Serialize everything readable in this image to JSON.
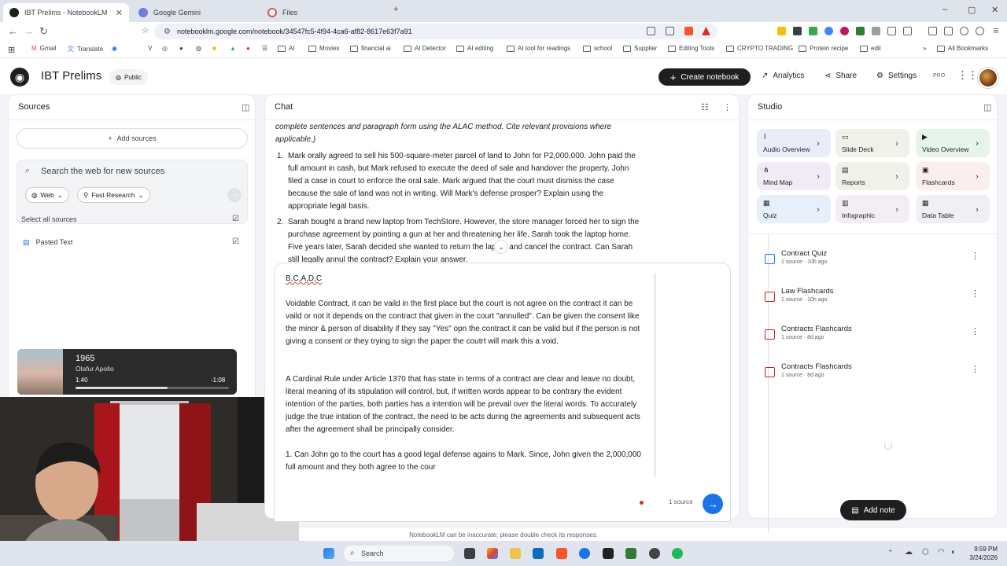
{
  "browser": {
    "tabs": [
      {
        "title": "IBT Prelims - NotebookLM",
        "active": true
      },
      {
        "title": "Google Gemini",
        "active": false
      },
      {
        "title": "Files",
        "active": false
      }
    ],
    "url": "notebooklm.google.com/notebook/34547fc5-4f94-4ca6-af82-8617e63f7a91",
    "bookmarks": [
      "Gmail",
      "Translate",
      "AI",
      "Movies",
      "financial ai",
      "AI Detector",
      "AI editing",
      "AI tool for readings",
      "school",
      "Supplier",
      "Editing Tools",
      "CRYPTO TRADING",
      "Protein recipe",
      "edit"
    ],
    "all_bookmarks": "All Bookmarks"
  },
  "app": {
    "notebook_title": "IBT Prelims",
    "public_label": "Public",
    "create_label": "Create notebook",
    "analytics_label": "Analytics",
    "share_label": "Share",
    "settings_label": "Settings",
    "pro_label": "PRO"
  },
  "sources": {
    "title": "Sources",
    "add_label": "Add sources",
    "search_placeholder": "Search the web for new sources",
    "web_chip": "Web",
    "research_chip": "Fast Research",
    "select_all": "Select all sources",
    "items": [
      {
        "label": "Pasted Text"
      }
    ]
  },
  "media": {
    "title": "1965",
    "artist": "Ólafur Apollo",
    "elapsed": "1:40",
    "remaining": "-1:08",
    "progress": 0.6
  },
  "chat": {
    "title": "Chat",
    "instruction": "complete sentences and paragraph form using the ALAC method. Cite relevant provisions where applicable.)",
    "questions": [
      {
        "num": "1.",
        "text": "Mark orally agreed to sell his 500-square-meter parcel of land to John for P2,000,000. John paid the full amount in cash, but Mark refused to execute the deed of sale and handover the property. John filed a case in court to enforce the oral sale. Mark argued that the court must dismiss the case because the sale of land was not in writing. Will Mark's defense prosper? Explain using the appropriate legal basis."
      },
      {
        "num": "2.",
        "text": "Sarah bought a brand new laptop from TechStore. However, the store manager forced her to sign the purchase agreement by pointing a gun at her and threatening her life. Sarah took the laptop home. Five years later, Sarah decided she wanted to return the laptop and cancel the contract. Can Sarah still legally annul the contract? Explain your answer."
      }
    ],
    "draft": {
      "p1": "B,C,A,D,C",
      "p2": "Voidable Contract, it can be vaild in the first place but the court is not agree on the contract it can be vaild or not it depends on the contract that given in the court \"annulled\". Can be given the consent like the minor & person of disability if they say \"Yes\" opn the contract it can be valid but if the person is not giving a consent or they trying to sign the paper the coutrt will mark this a void.",
      "p3": "A Cardinal Rule under Article 1370 that has state in terms of a contract are clear and leave no doubt, literal meaning of its stipulation will control, but, if written words appear to be contrary the evident intention of the parties, both parties has a intention will be prevail over the literal words. To accurately judge the true intation of the contract, the need to be acts during the agreements and subsequent acts after the agreement shall be principally consider.",
      "p4": "1. Can John go to the court has a good legal defense agains to Mark. Since, John given the 2,000,000 full amount and they both agree to the cour"
    },
    "source_count": "1 source",
    "disclaimer": "NotebookLM can be inaccurate; please double check its responses."
  },
  "studio": {
    "title": "Studio",
    "tiles": [
      {
        "label": "Audio Overview",
        "color": "#e9edf9",
        "icon": "waveform-icon"
      },
      {
        "label": "Slide Deck",
        "color": "#f1f1ea",
        "icon": "slides-icon"
      },
      {
        "label": "Video Overview",
        "color": "#e6f4ea",
        "icon": "video-icon"
      },
      {
        "label": "Mind Map",
        "color": "#f1ebf5",
        "icon": "mindmap-icon"
      },
      {
        "label": "Reports",
        "color": "#f1f1ea",
        "icon": "report-icon"
      },
      {
        "label": "Flashcards",
        "color": "#fbeeee",
        "icon": "flashcards-icon"
      },
      {
        "label": "Quiz",
        "color": "#e7f0fa",
        "icon": "quiz-icon"
      },
      {
        "label": "Infographic",
        "color": "#f3eef6",
        "icon": "infographic-icon"
      },
      {
        "label": "Data Table",
        "color": "#eef0f3",
        "icon": "table-icon"
      }
    ],
    "notes": [
      {
        "title": "Contract Quiz",
        "sub": "1 source · 10h ago"
      },
      {
        "title": "Law Flashcards",
        "sub": "1 source · 10h ago"
      },
      {
        "title": "Contracts Flashcards",
        "sub": "1 source · 8d ago"
      },
      {
        "title": "Contracts Flashcards",
        "sub": "1 source · 8d ago"
      }
    ],
    "add_note_label": "Add note"
  },
  "taskbar": {
    "search_label": "Search",
    "time": "9:59 PM",
    "date": "3/24/2026"
  }
}
